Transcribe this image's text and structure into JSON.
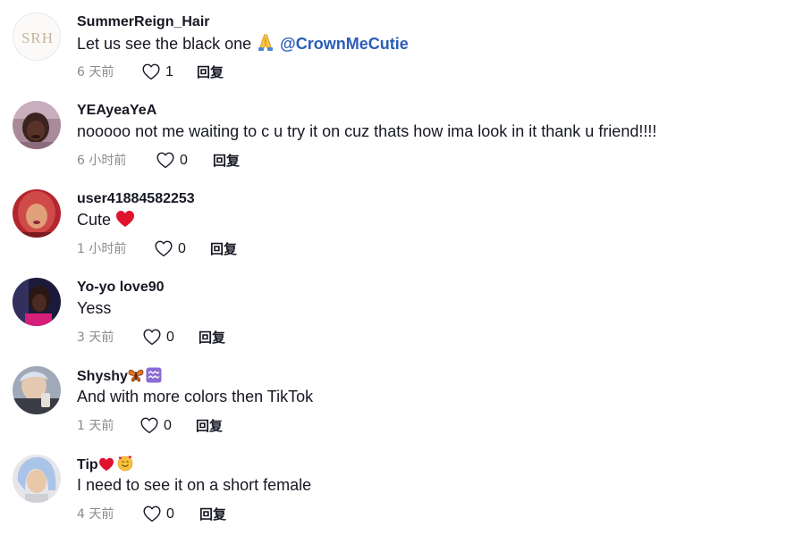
{
  "comments": [
    {
      "username": "SummerReign_Hair",
      "avatar_text": "SRH",
      "text": "Let us see the black one",
      "emoji": "folded-hands",
      "mention": "@CrownMeCutie",
      "time": "6 天前",
      "likes": "1",
      "reply_label": "回复"
    },
    {
      "username": "YEAyeaYeA",
      "text": "nooooo not me waiting to c u try it on cuz thats how ima look in it thank u friend!!!!",
      "time": "6 小时前",
      "likes": "0",
      "reply_label": "回复"
    },
    {
      "username": "user41884582253",
      "text": "Cute",
      "emoji": "red-heart",
      "time": "1 小时前",
      "likes": "0",
      "reply_label": "回复"
    },
    {
      "username": "Yo-yo love90",
      "text": "Yess",
      "time": "3 天前",
      "likes": "0",
      "reply_label": "回复"
    },
    {
      "username": "Shyshy",
      "username_emojis": [
        "butterfly",
        "aquarius"
      ],
      "text": "And with more colors then TikTok",
      "time": "1 天前",
      "likes": "0",
      "reply_label": "回复"
    },
    {
      "username": "Tip",
      "username_emojis": [
        "red-heart",
        "smiling-face-with-hearts"
      ],
      "text": "I need to see it on a short female",
      "time": "4 天前",
      "likes": "0",
      "reply_label": "回复"
    }
  ],
  "colors": {
    "text": "#161823",
    "muted": "#8a8b91",
    "mention": "#2b5db9",
    "heart": "#e0132e"
  }
}
